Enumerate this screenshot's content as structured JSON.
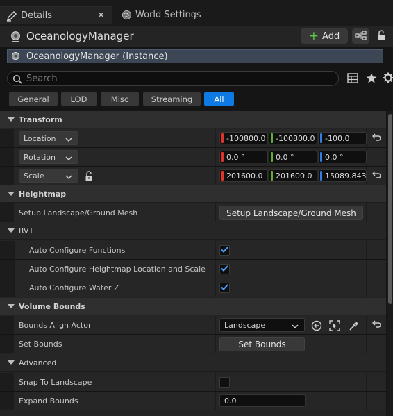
{
  "tabs": [
    {
      "label": "Details",
      "active": true,
      "icon": "pencil-icon"
    },
    {
      "label": "World Settings",
      "active": false,
      "icon": "globe-icon"
    }
  ],
  "header": {
    "actor_name": "OceanologyManager",
    "add_label": "Add",
    "instance_label": "OceanologyManager (Instance)"
  },
  "search": {
    "placeholder": "Search",
    "value": ""
  },
  "filters": [
    "General",
    "LOD",
    "Misc",
    "Streaming",
    "All"
  ],
  "active_filter": "All",
  "colors": {
    "accent": "#0f7ae4",
    "x_axis": "#e0342b",
    "y_axis": "#62b12e",
    "z_axis": "#2f7fe6",
    "add_plus": "#5fc94a"
  },
  "transform": {
    "title": "Transform",
    "location": {
      "label": "Location",
      "x": "-100800.0",
      "y": "-100800.0",
      "z": "-100.0"
    },
    "rotation": {
      "label": "Rotation",
      "x": "0.0 °",
      "y": "0.0 °",
      "z": "0.0 °"
    },
    "scale": {
      "label": "Scale",
      "x": "201600.0",
      "y": "201600.0",
      "z": "15089.843"
    }
  },
  "heightmap": {
    "title": "Heightmap",
    "setup_label": "Setup Landscape/Ground Mesh",
    "setup_button": "Setup Landscape/Ground Mesh"
  },
  "rvt": {
    "title": "RVT",
    "items": [
      {
        "label": "Auto Configure Functions",
        "checked": true
      },
      {
        "label": "Auto Configure Heightmap Location and Scale",
        "checked": true
      },
      {
        "label": "Auto Configure Water Z",
        "checked": true
      }
    ]
  },
  "volume_bounds": {
    "title": "Volume Bounds",
    "align_label": "Bounds Align Actor",
    "align_value": "Landscape",
    "set_label": "Set Bounds",
    "set_button": "Set Bounds"
  },
  "advanced": {
    "title": "Advanced",
    "snap_label": "Snap To Landscape",
    "snap_checked": false,
    "expand_label": "Expand Bounds",
    "expand_value": "0.0"
  }
}
